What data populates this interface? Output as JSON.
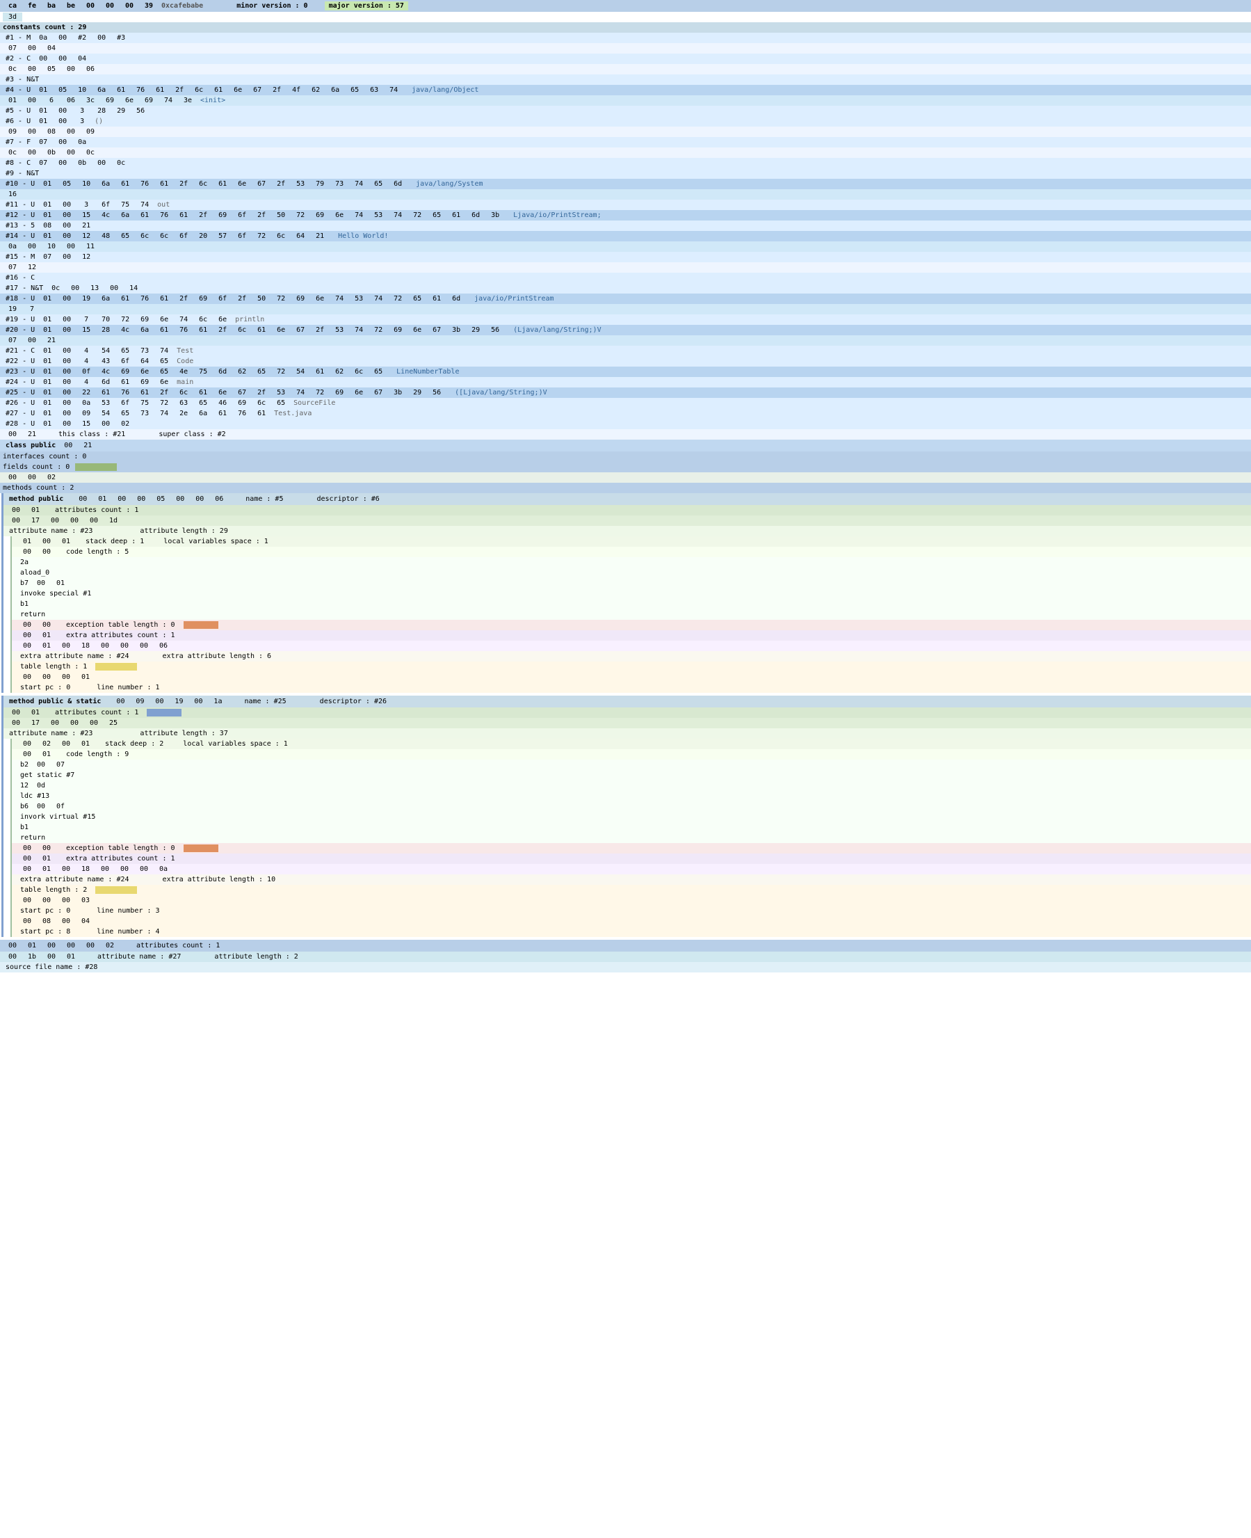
{
  "header": {
    "cols": [
      "ca",
      "fe",
      "ba",
      "be",
      "00",
      "00",
      "00",
      "39"
    ],
    "magic": "0xcafebabe",
    "minor_version_label": "minor version : 0",
    "major_version_label": "major version : 57"
  },
  "constants_count": "constants count : 29",
  "entries": [
    {
      "id": "#1 - M",
      "hex": [
        "0a",
        "00",
        "#2",
        "00",
        "03"
      ]
    },
    {
      "id": "#2 - C",
      "hex": [
        "07",
        "00",
        "00",
        "04"
      ]
    },
    {
      "id": "#3 - N&T",
      "hex": [
        "0c",
        "00",
        "05",
        "00",
        "06"
      ]
    },
    {
      "id": "#4 - U",
      "hex": [
        "01",
        "05",
        "10",
        "6a",
        "61",
        "76",
        "61",
        "2f",
        "6c",
        "61",
        "6e",
        "67",
        "2f",
        "4f",
        "62",
        "6a",
        "65",
        "63",
        "74"
      ],
      "label": "java/lang/Object"
    },
    {
      "id": "#5 - U",
      "hex": [
        "01",
        "00",
        "6",
        "06",
        "3c",
        "69",
        "6e",
        "69",
        "74",
        "3e"
      ],
      "label": "<init>"
    },
    {
      "id": "#6 - U",
      "hex": [
        "01",
        "00",
        "3",
        "28",
        "29",
        "56"
      ],
      "label": "()V"
    },
    {
      "id": "#7 - F",
      "hex": [
        "09",
        "00",
        "08",
        "00",
        "09"
      ]
    },
    {
      "id": "#8 - C",
      "hex": [
        "07",
        "00",
        "0a"
      ]
    },
    {
      "id": "#9 - N&T",
      "hex": [
        "0c",
        "00",
        "0b",
        "00",
        "0c"
      ]
    },
    {
      "id": "#10 - U",
      "hex": [
        "01",
        "00",
        "10",
        "6a",
        "61",
        "76",
        "61",
        "2f",
        "6c",
        "61",
        "6e",
        "67",
        "2f",
        "53",
        "79",
        "73",
        "74",
        "65",
        "6d"
      ],
      "label": "java/lang/System"
    },
    {
      "id": "#11 - U",
      "hex": [
        "01",
        "00",
        "3",
        "6f",
        "75",
        "74"
      ],
      "label": "out"
    },
    {
      "id": "#12 - U",
      "hex": [
        "01",
        "00",
        "15",
        "4c",
        "6a",
        "61",
        "76",
        "61",
        "2f",
        "69",
        "6f",
        "2f",
        "50",
        "72",
        "69",
        "6e",
        "74",
        "53",
        "74",
        "72",
        "65",
        "61",
        "6d",
        "3b"
      ],
      "label": "Ljava/io/PrintStream;"
    },
    {
      "id": "#13 - S",
      "hex": [
        "08",
        "00",
        "21"
      ]
    },
    {
      "id": "#14 - U",
      "hex": [
        "01",
        "00",
        "12",
        "48",
        "65",
        "6c",
        "6c",
        "6f",
        "20",
        "57",
        "6f",
        "72",
        "6c",
        "64",
        "21"
      ],
      "label": "Hello World!"
    },
    {
      "id": "#15 - M",
      "hex": [
        "0a",
        "00",
        "10",
        "00",
        "11"
      ]
    },
    {
      "id": "#16 - C",
      "hex": [
        "07",
        "00",
        "12"
      ]
    },
    {
      "id": "#17 - N&T",
      "hex": [
        "0c",
        "00",
        "13",
        "00",
        "14"
      ]
    },
    {
      "id": "#18 - U",
      "hex": [
        "01",
        "00",
        "19",
        "6a",
        "61",
        "76",
        "61",
        "2f",
        "69",
        "6f",
        "2f",
        "50",
        "72",
        "69",
        "6e",
        "74",
        "53",
        "74",
        "72",
        "65",
        "61",
        "6d"
      ],
      "label": "java/io/PrintStream"
    },
    {
      "id": "#19 - U",
      "hex": [
        "01",
        "00",
        "7",
        "70",
        "72",
        "69",
        "6e",
        "74",
        "6c",
        "6e"
      ],
      "label": "println"
    },
    {
      "id": "#20 - U",
      "hex": [
        "01",
        "00",
        "15",
        "28",
        "4c",
        "6a",
        "61",
        "76",
        "61",
        "2f",
        "6c",
        "61",
        "6e",
        "67",
        "2f",
        "53",
        "74",
        "72",
        "69",
        "6e",
        "67",
        "3b",
        "29",
        "56"
      ],
      "label": "(Ljava/lang/String;)V"
    },
    {
      "id": "#21 - C",
      "hex": [
        "07",
        "00",
        "22"
      ]
    },
    {
      "id": "#22 - U",
      "hex": [
        "01",
        "00",
        "4",
        "54",
        "65",
        "73",
        "74"
      ],
      "label": "Test"
    },
    {
      "id": "#23 - U",
      "hex": [
        "01",
        "00",
        "4",
        "43",
        "6f",
        "64",
        "65"
      ],
      "label": "Code"
    },
    {
      "id": "#24 - U",
      "hex": [
        "01",
        "00",
        "15",
        "4c",
        "69",
        "6e",
        "65",
        "4e",
        "75",
        "6d",
        "62",
        "65",
        "72",
        "54",
        "61",
        "62",
        "6c",
        "65"
      ],
      "label": "LineNumberTable"
    },
    {
      "id": "#25 - U",
      "hex": [
        "01",
        "00",
        "4",
        "6d",
        "61",
        "69",
        "6e"
      ],
      "label": "main"
    },
    {
      "id": "#26 - U",
      "hex": [
        "01",
        "00",
        "22",
        "61",
        "76",
        "61",
        "2f",
        "6c",
        "61",
        "6e",
        "67",
        "2f",
        "53",
        "74",
        "72",
        "69",
        "6e",
        "67",
        "3b",
        "29",
        "56"
      ],
      "label": "([Ljava/lang/String;)V"
    },
    {
      "id": "#27 - U",
      "hex": [
        "01",
        "00",
        "9",
        "54",
        "65",
        "73",
        "74",
        "2e",
        "6a",
        "61",
        "76",
        "61"
      ],
      "label": "Test.java"
    },
    {
      "id": "#28 - U",
      "hex": [
        "01",
        "00",
        "15",
        "00",
        "02"
      ],
      "class_info": "this class : #21",
      "super_class": "super class : #2"
    },
    {
      "id": "class public",
      "hex": [
        "00",
        "21"
      ]
    }
  ],
  "class_info": {
    "interfaces_count": "interfaces count : 0",
    "fields_count": "fields count : 0",
    "methods_count": "methods count : 2",
    "method1": {
      "label": "method public",
      "hex": [
        "00",
        "01",
        "00",
        "00",
        "05",
        "00",
        "00",
        "06"
      ],
      "name": "name : #5",
      "descriptor": "descriptor : #6",
      "attributes_count": "attributes count : 1",
      "attr_hex": [
        "00",
        "17",
        "00",
        "00",
        "00",
        "1d"
      ],
      "attr_name": "attribute name : #23",
      "attr_length": "attribute length : 29",
      "code": {
        "stack_deep": "stack deep : 1",
        "local_vars": "local variables space : 1",
        "hex": [
          "01",
          "00",
          "01"
        ],
        "code_length": "code length : 5",
        "instructions": [
          "2a",
          "aload_0",
          "b7",
          "00",
          "01",
          "invoke special #1",
          "b1",
          "return"
        ],
        "exception_table_length": "exception table length : 0",
        "extra_attrs_count": "extra attributes count : 1",
        "extra_hex": [
          "00",
          "01",
          "00",
          "18",
          "00",
          "00",
          "00",
          "06"
        ],
        "extra_attr_name": "extra attribute name : #24",
        "extra_attr_length": "extra attribute length : 6",
        "table_length": "table length : 1",
        "table_hex": [
          "00",
          "00",
          "00",
          "01"
        ],
        "start_pc": "start pc : 0",
        "line_number": "line number : 1"
      }
    },
    "method2": {
      "label": "method public & static",
      "hex": [
        "00",
        "09",
        "00",
        "19",
        "00",
        "1a"
      ],
      "name": "name : #25",
      "descriptor": "descriptor : #26",
      "attributes_count": "attributes count : 1",
      "attr_hex": [
        "00",
        "17",
        "00",
        "00",
        "00",
        "25"
      ],
      "attr_name": "attribute name : #23",
      "attr_length": "attribute length : 37",
      "code": {
        "stack_deep": "stack deep : 2",
        "local_vars": "local variables space : 1",
        "hex": [
          "00",
          "02",
          "00",
          "01"
        ],
        "code_length": "code length : 9",
        "instructions": [
          "b2",
          "00",
          "07",
          "get static #7",
          "12",
          "0d",
          "ldc #13",
          "b6",
          "00",
          "0f",
          "invork virtual #15",
          "b1",
          "return"
        ],
        "exception_table_length": "exception table length : 0",
        "extra_attrs_count": "extra attributes count : 1",
        "extra_hex": [
          "00",
          "01",
          "00",
          "18",
          "00",
          "00",
          "00",
          "0a"
        ],
        "extra_attr_name": "extra attribute name : #24",
        "extra_attr_length": "extra attribute length : 10",
        "table_length": "table length : 2",
        "table_hex": [
          "00",
          "00",
          "00",
          "03"
        ],
        "entries": [
          {
            "start_pc": "start pc : 0",
            "line_number": "line number : 3"
          },
          {
            "hex": [
              "00",
              "08",
              "00",
              "04"
            ],
            "start_pc": "start pc : 8",
            "line_number": "line number : 4"
          }
        ]
      }
    }
  },
  "file_attrs": {
    "count": "attributes count : 1",
    "hex": [
      "00",
      "1b",
      "00",
      "01",
      "00",
      "00",
      "00",
      "02"
    ],
    "attr_name": "attribute name : #27",
    "attr_length": "attribute length : 2",
    "source_file": "source file name : #28"
  }
}
